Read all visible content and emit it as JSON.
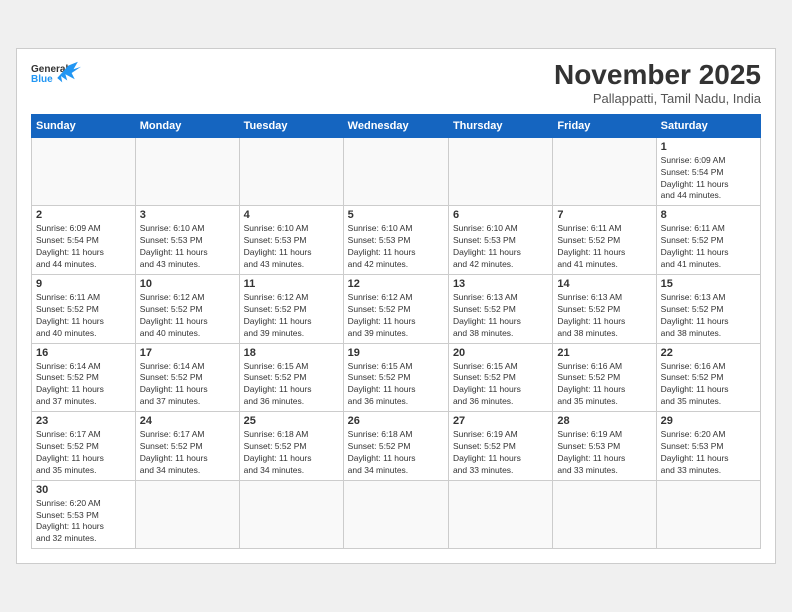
{
  "header": {
    "logo_general": "General",
    "logo_blue": "Blue",
    "month_title": "November 2025",
    "subtitle": "Pallappatti, Tamil Nadu, India"
  },
  "weekdays": [
    "Sunday",
    "Monday",
    "Tuesday",
    "Wednesday",
    "Thursday",
    "Friday",
    "Saturday"
  ],
  "days": [
    {
      "num": "",
      "info": ""
    },
    {
      "num": "",
      "info": ""
    },
    {
      "num": "",
      "info": ""
    },
    {
      "num": "",
      "info": ""
    },
    {
      "num": "",
      "info": ""
    },
    {
      "num": "",
      "info": ""
    },
    {
      "num": "1",
      "info": "Sunrise: 6:09 AM\nSunset: 5:54 PM\nDaylight: 11 hours\nand 44 minutes."
    },
    {
      "num": "2",
      "info": "Sunrise: 6:09 AM\nSunset: 5:54 PM\nDaylight: 11 hours\nand 44 minutes."
    },
    {
      "num": "3",
      "info": "Sunrise: 6:10 AM\nSunset: 5:53 PM\nDaylight: 11 hours\nand 43 minutes."
    },
    {
      "num": "4",
      "info": "Sunrise: 6:10 AM\nSunset: 5:53 PM\nDaylight: 11 hours\nand 43 minutes."
    },
    {
      "num": "5",
      "info": "Sunrise: 6:10 AM\nSunset: 5:53 PM\nDaylight: 11 hours\nand 42 minutes."
    },
    {
      "num": "6",
      "info": "Sunrise: 6:10 AM\nSunset: 5:53 PM\nDaylight: 11 hours\nand 42 minutes."
    },
    {
      "num": "7",
      "info": "Sunrise: 6:11 AM\nSunset: 5:52 PM\nDaylight: 11 hours\nand 41 minutes."
    },
    {
      "num": "8",
      "info": "Sunrise: 6:11 AM\nSunset: 5:52 PM\nDaylight: 11 hours\nand 41 minutes."
    },
    {
      "num": "9",
      "info": "Sunrise: 6:11 AM\nSunset: 5:52 PM\nDaylight: 11 hours\nand 40 minutes."
    },
    {
      "num": "10",
      "info": "Sunrise: 6:12 AM\nSunset: 5:52 PM\nDaylight: 11 hours\nand 40 minutes."
    },
    {
      "num": "11",
      "info": "Sunrise: 6:12 AM\nSunset: 5:52 PM\nDaylight: 11 hours\nand 39 minutes."
    },
    {
      "num": "12",
      "info": "Sunrise: 6:12 AM\nSunset: 5:52 PM\nDaylight: 11 hours\nand 39 minutes."
    },
    {
      "num": "13",
      "info": "Sunrise: 6:13 AM\nSunset: 5:52 PM\nDaylight: 11 hours\nand 38 minutes."
    },
    {
      "num": "14",
      "info": "Sunrise: 6:13 AM\nSunset: 5:52 PM\nDaylight: 11 hours\nand 38 minutes."
    },
    {
      "num": "15",
      "info": "Sunrise: 6:13 AM\nSunset: 5:52 PM\nDaylight: 11 hours\nand 38 minutes."
    },
    {
      "num": "16",
      "info": "Sunrise: 6:14 AM\nSunset: 5:52 PM\nDaylight: 11 hours\nand 37 minutes."
    },
    {
      "num": "17",
      "info": "Sunrise: 6:14 AM\nSunset: 5:52 PM\nDaylight: 11 hours\nand 37 minutes."
    },
    {
      "num": "18",
      "info": "Sunrise: 6:15 AM\nSunset: 5:52 PM\nDaylight: 11 hours\nand 36 minutes."
    },
    {
      "num": "19",
      "info": "Sunrise: 6:15 AM\nSunset: 5:52 PM\nDaylight: 11 hours\nand 36 minutes."
    },
    {
      "num": "20",
      "info": "Sunrise: 6:15 AM\nSunset: 5:52 PM\nDaylight: 11 hours\nand 36 minutes."
    },
    {
      "num": "21",
      "info": "Sunrise: 6:16 AM\nSunset: 5:52 PM\nDaylight: 11 hours\nand 35 minutes."
    },
    {
      "num": "22",
      "info": "Sunrise: 6:16 AM\nSunset: 5:52 PM\nDaylight: 11 hours\nand 35 minutes."
    },
    {
      "num": "23",
      "info": "Sunrise: 6:17 AM\nSunset: 5:52 PM\nDaylight: 11 hours\nand 35 minutes."
    },
    {
      "num": "24",
      "info": "Sunrise: 6:17 AM\nSunset: 5:52 PM\nDaylight: 11 hours\nand 34 minutes."
    },
    {
      "num": "25",
      "info": "Sunrise: 6:18 AM\nSunset: 5:52 PM\nDaylight: 11 hours\nand 34 minutes."
    },
    {
      "num": "26",
      "info": "Sunrise: 6:18 AM\nSunset: 5:52 PM\nDaylight: 11 hours\nand 34 minutes."
    },
    {
      "num": "27",
      "info": "Sunrise: 6:19 AM\nSunset: 5:52 PM\nDaylight: 11 hours\nand 33 minutes."
    },
    {
      "num": "28",
      "info": "Sunrise: 6:19 AM\nSunset: 5:53 PM\nDaylight: 11 hours\nand 33 minutes."
    },
    {
      "num": "29",
      "info": "Sunrise: 6:20 AM\nSunset: 5:53 PM\nDaylight: 11 hours\nand 33 minutes."
    },
    {
      "num": "30",
      "info": "Sunrise: 6:20 AM\nSunset: 5:53 PM\nDaylight: 11 hours\nand 32 minutes."
    },
    {
      "num": "",
      "info": ""
    },
    {
      "num": "",
      "info": ""
    },
    {
      "num": "",
      "info": ""
    },
    {
      "num": "",
      "info": ""
    },
    {
      "num": "",
      "info": ""
    },
    {
      "num": "",
      "info": ""
    }
  ]
}
